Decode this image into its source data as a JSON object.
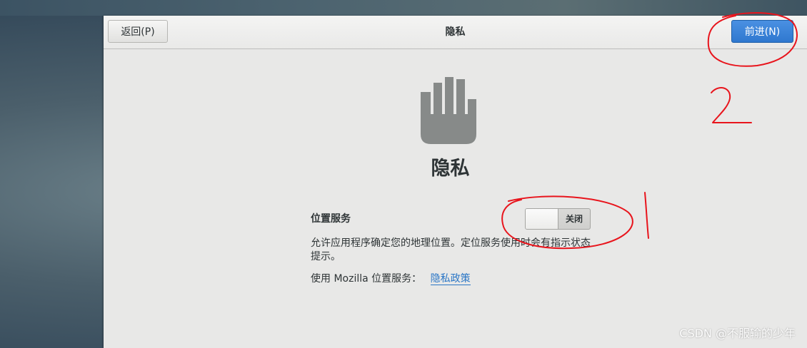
{
  "header": {
    "back_label": "返回(P)",
    "title": "隐私",
    "next_label": "前进(N)"
  },
  "page": {
    "icon": "hand-privacy-icon",
    "title": "隐私"
  },
  "location_services": {
    "label": "位置服务",
    "switch_state": "关闭",
    "enabled": false,
    "description": "允许应用程序确定您的地理位置。定位服务使用时会有指示状态提示。",
    "mozilla_text": "使用 Mozilla 位置服务：",
    "policy_link": "隐私政策"
  },
  "annotations": {
    "marks": [
      "1",
      "2"
    ],
    "color": "#e8141c"
  },
  "watermark": "CSDN @不服输的少年",
  "colors": {
    "accent": "#2f78cf",
    "link": "#2a76c6",
    "window_bg": "#e8e8e7"
  }
}
